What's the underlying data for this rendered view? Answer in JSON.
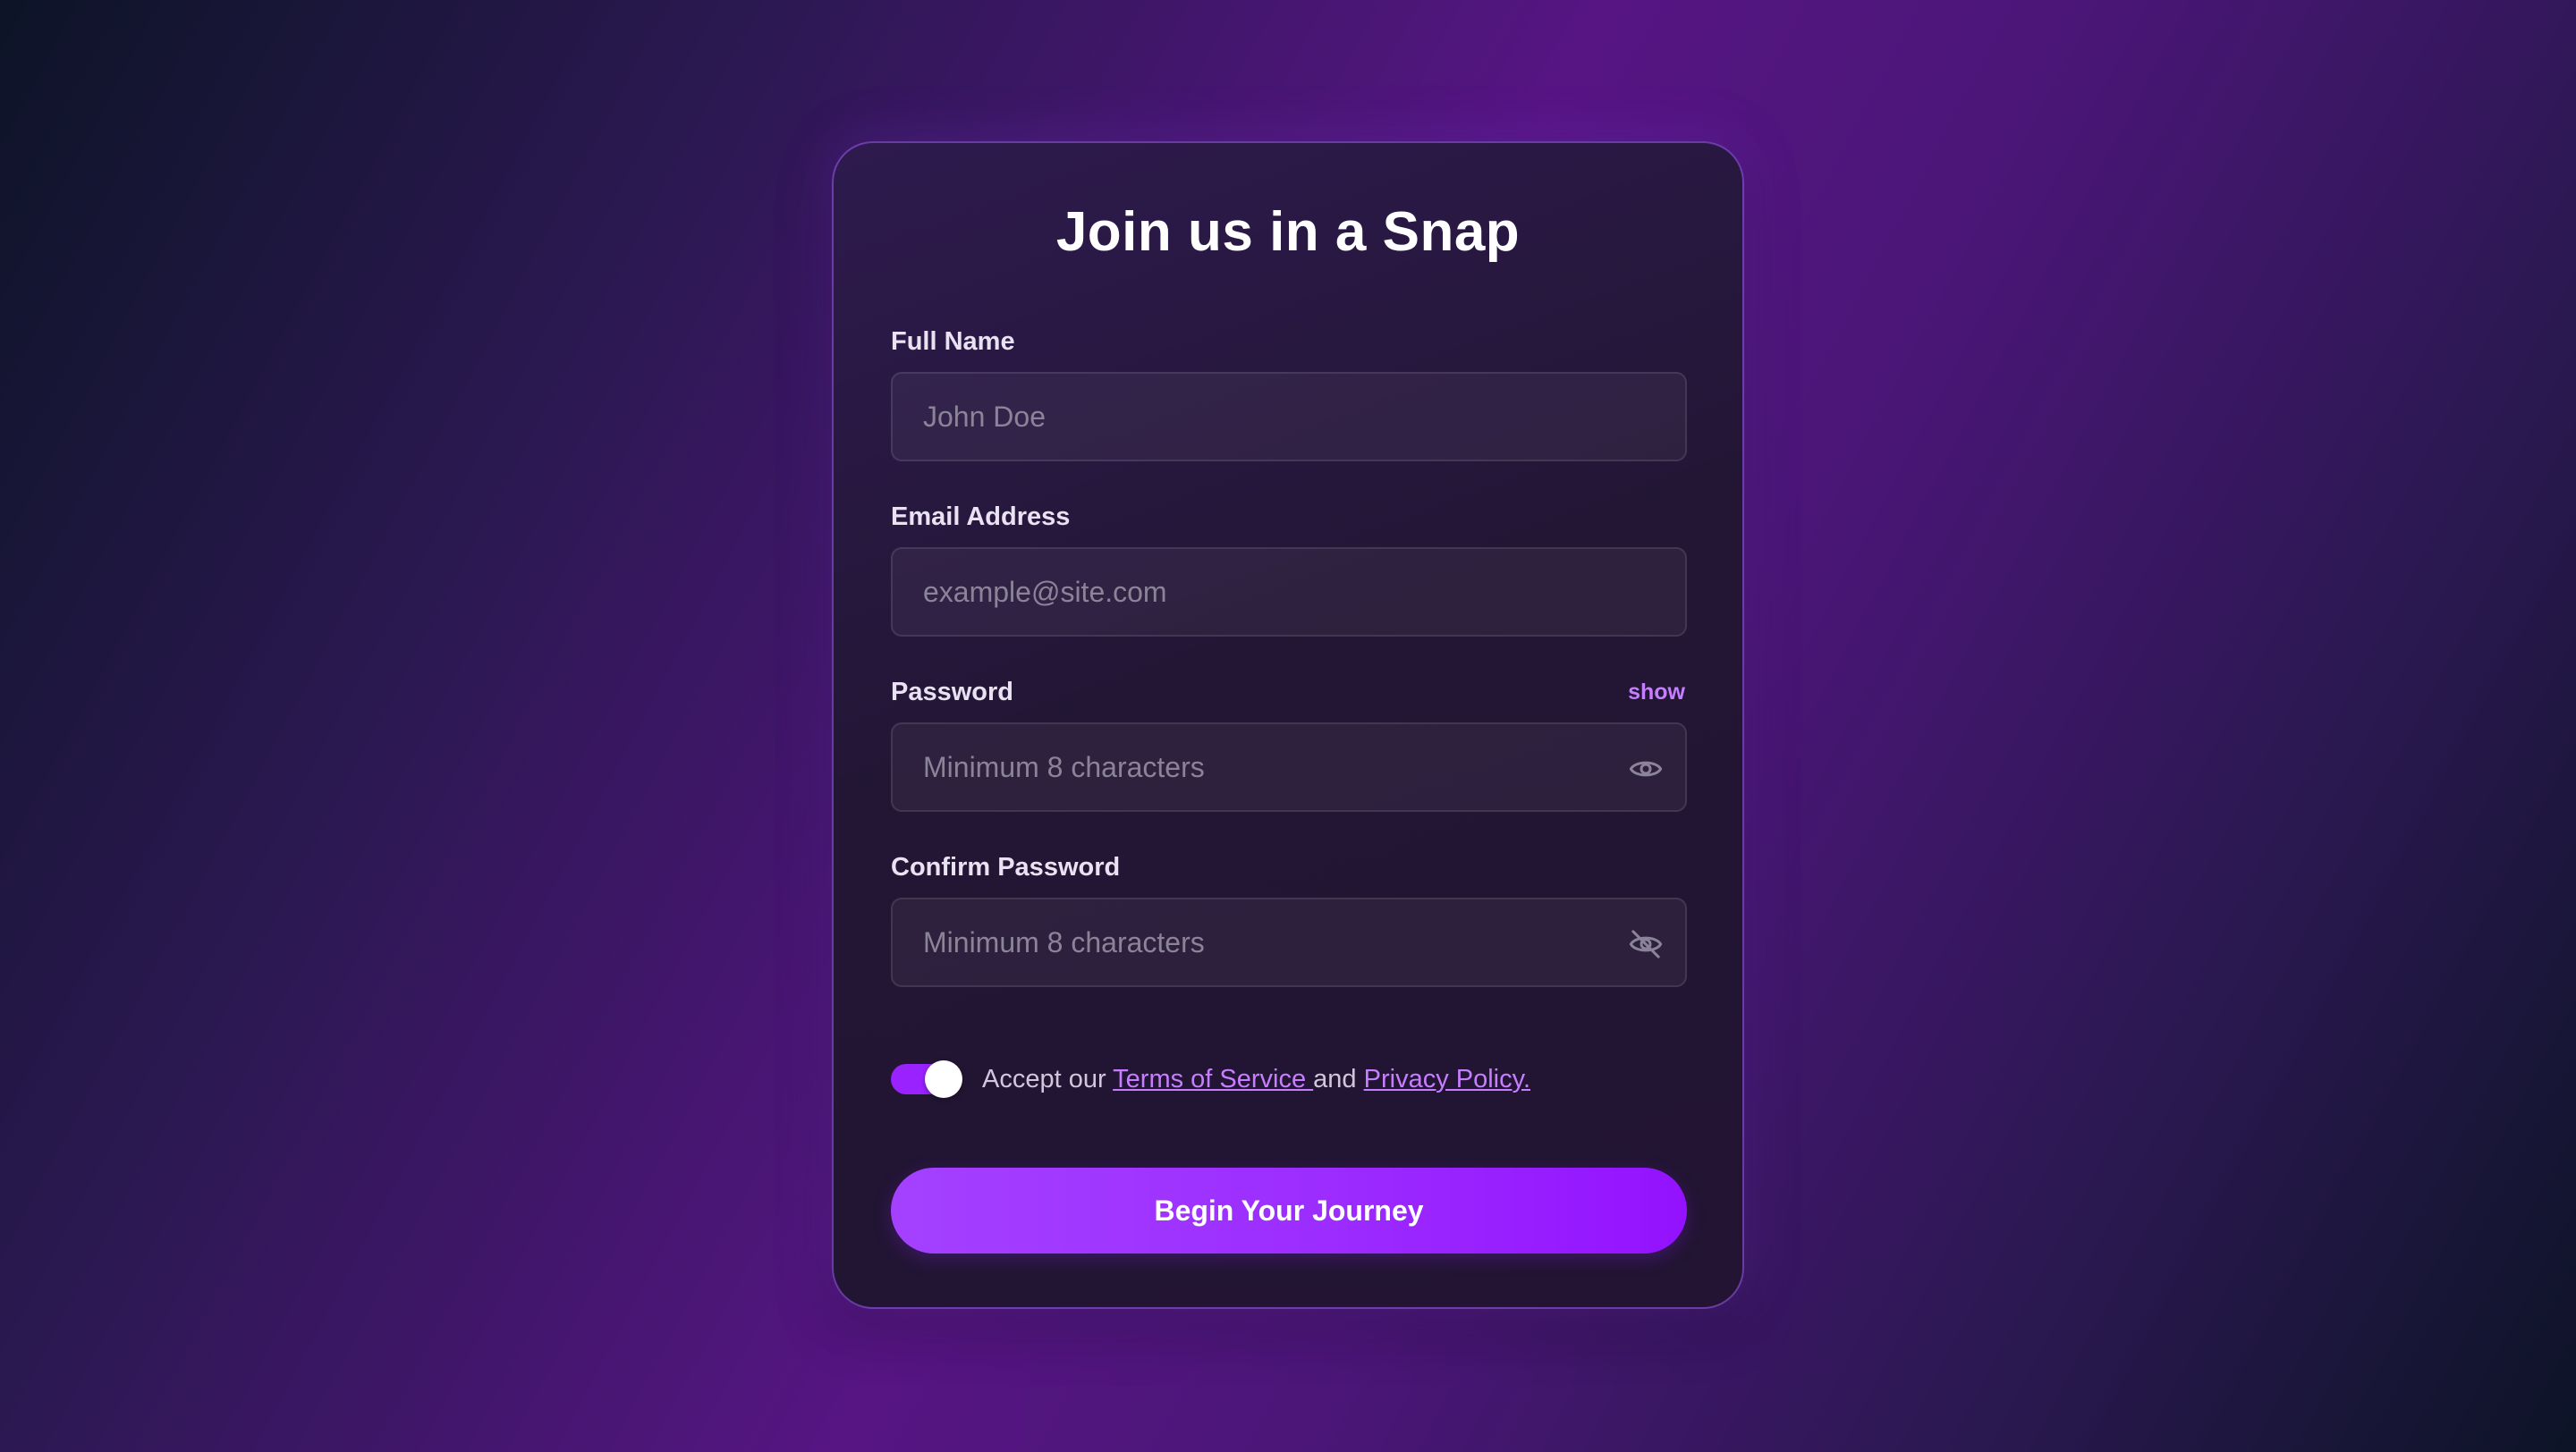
{
  "form": {
    "title": "Join us in a Snap",
    "full_name": {
      "label": "Full Name",
      "placeholder": "John Doe",
      "value": ""
    },
    "email": {
      "label": "Email Address",
      "placeholder": "example@site.com",
      "value": ""
    },
    "password": {
      "label": "Password",
      "toggle_label": "show",
      "placeholder": "Minimum 8 characters",
      "value": "",
      "icon": "eye-icon"
    },
    "confirm_password": {
      "label": "Confirm Password",
      "placeholder": "Minimum 8 characters",
      "value": "",
      "icon": "eye-off-icon"
    },
    "terms": {
      "checked": true,
      "prefix": "Accept our ",
      "tos_link": "Terms of Service ",
      "connector": "and ",
      "privacy_link": "Privacy Policy."
    },
    "submit_label": "Begin Your Journey"
  },
  "colors": {
    "accent": "#9a22ff",
    "link": "#c77dff",
    "card_border": "#a25cff"
  }
}
